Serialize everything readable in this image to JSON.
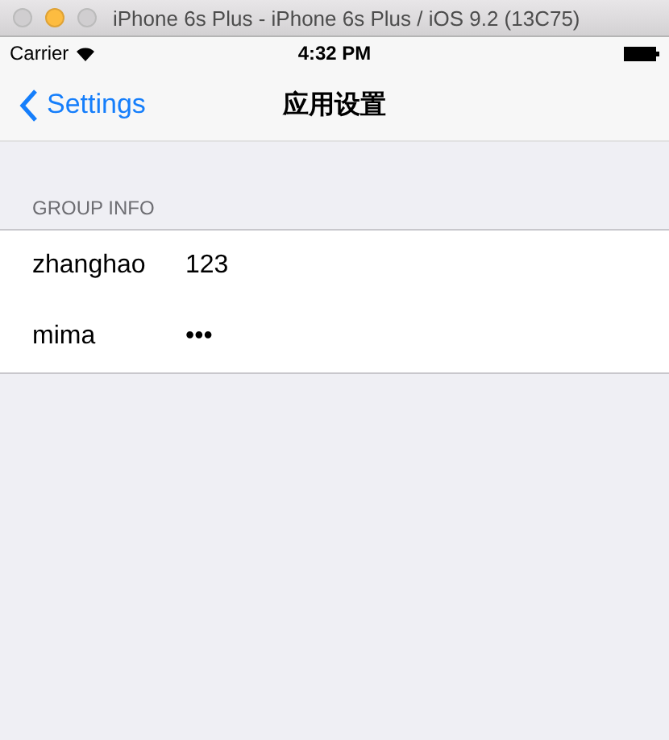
{
  "window": {
    "title": "iPhone 6s Plus - iPhone 6s Plus / iOS 9.2 (13C75)"
  },
  "status_bar": {
    "carrier": "Carrier",
    "time": "4:32 PM"
  },
  "nav_bar": {
    "back": "Settings",
    "title": "应用设置"
  },
  "section": {
    "header": "GROUP INFO",
    "rows": [
      {
        "label": "zhanghao",
        "value": "123"
      },
      {
        "label": "mima",
        "value": "•••"
      }
    ]
  }
}
